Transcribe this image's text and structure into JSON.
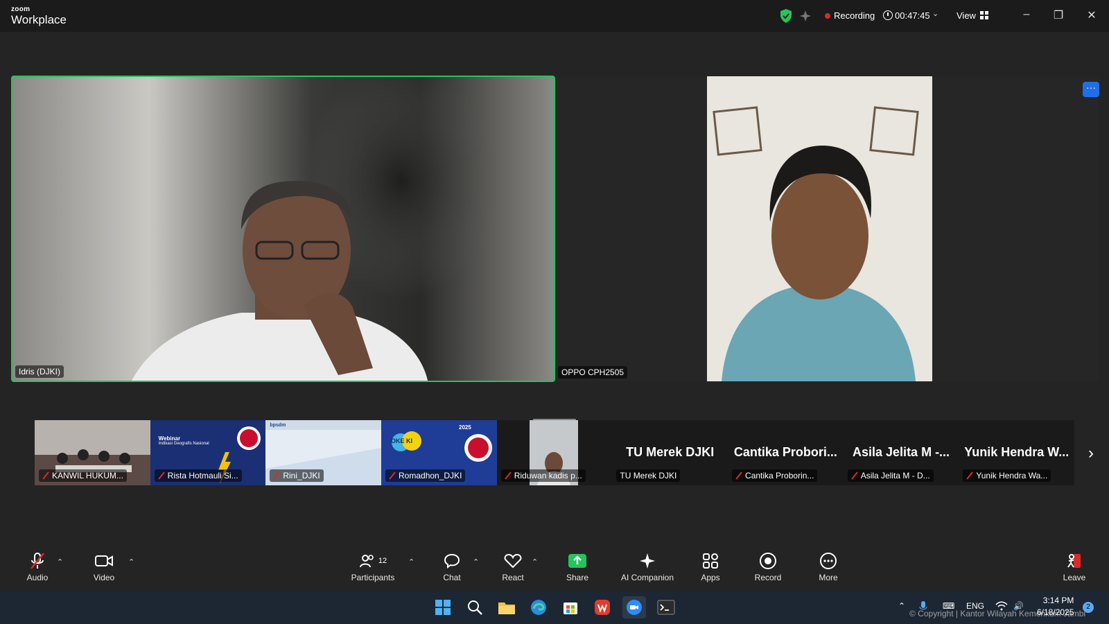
{
  "app": {
    "logo_small": "zoom",
    "logo_big": "Workplace",
    "recording_label": "Recording",
    "timer": "00:47:45",
    "view_label": "View",
    "accent_green": "#22c55e",
    "record_red": "#e02828"
  },
  "main_tiles": [
    {
      "name": "Idris (DJKI)",
      "active_speaker": true
    },
    {
      "name": "OPPO CPH2505",
      "active_speaker": false
    }
  ],
  "more_button_label": "···",
  "strip": [
    {
      "name": "KANWIL HUKUM...",
      "type": "video"
    },
    {
      "name": "Rista Hotmauli Si...",
      "type": "share"
    },
    {
      "name": "Rini_DJKI",
      "type": "share"
    },
    {
      "name": "Romadhon_DJKI",
      "type": "share"
    },
    {
      "name": "Riduwan kadis p...",
      "type": "video"
    },
    {
      "name": "TU Merek DJKI",
      "display": "TU Merek DJKI",
      "type": "name"
    },
    {
      "name": "Cantika Proborin...",
      "display": "Cantika Probori...",
      "type": "name"
    },
    {
      "name": "Asila Jelita M - D...",
      "display": "Asila Jelita M -...",
      "type": "name"
    },
    {
      "name": "Yunik Hendra Wa...",
      "display": "Yunik Hendra W...",
      "type": "name"
    }
  ],
  "strip_thumb_texts": {
    "webinar_title": "Webinar",
    "webinar_sub": "Indikasi Geografis Nasional",
    "bpsdm": "bpsdm",
    "okeki": "OKE KI",
    "year": "2025"
  },
  "toolbar": {
    "audio": "Audio",
    "video": "Video",
    "participants": "Participants",
    "participants_count": "12",
    "chat": "Chat",
    "react": "React",
    "share": "Share",
    "ai": "AI Companion",
    "apps": "Apps",
    "record": "Record",
    "more": "More",
    "leave": "Leave"
  },
  "taskbar": {
    "lang": "ENG",
    "time": "3:14 PM",
    "date": "6/18/2025",
    "notifications": "2",
    "copyright": "© Copyright | Kantor Wilayah Kemenkum Jambi"
  }
}
